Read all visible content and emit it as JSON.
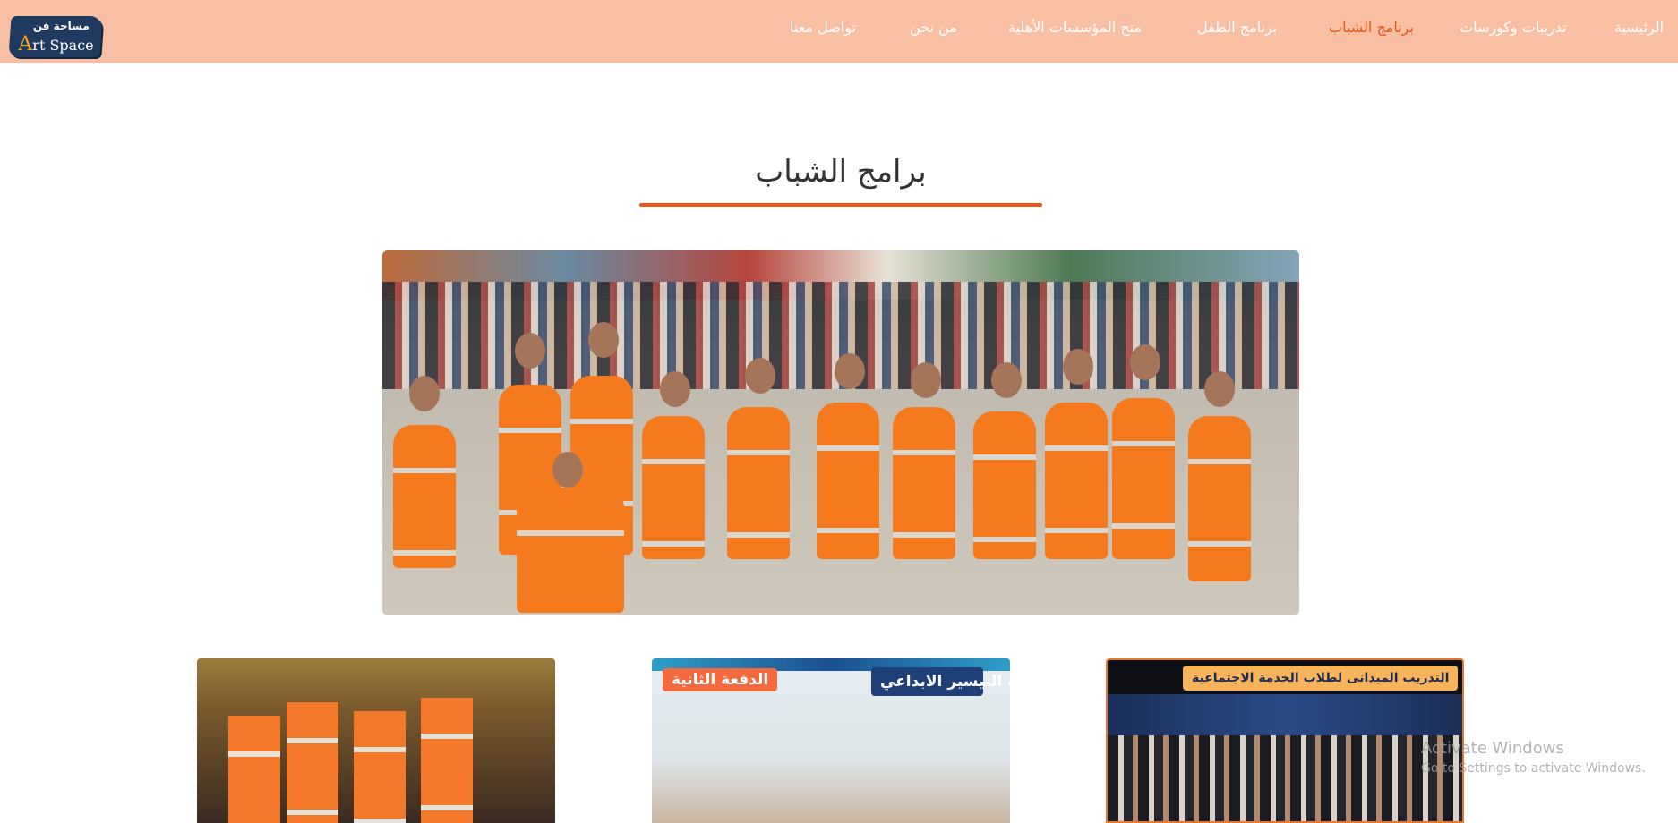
{
  "nav": {
    "logo": {
      "arabic": "مساحة فن",
      "latin": "Art Space",
      "icon": "art-space-logo"
    },
    "items": [
      {
        "label": "الرئيسية",
        "active": false
      },
      {
        "label": "تدريبات وكورسات",
        "active": false
      },
      {
        "label": "برنامج الشباب",
        "active": true
      },
      {
        "label": "برنامج الطفل",
        "active": false
      },
      {
        "label": "منح المؤسسات الأهلية",
        "active": false
      },
      {
        "label": "من نحن",
        "active": false
      },
      {
        "label": "تواصل معنا",
        "active": false
      }
    ],
    "colors": {
      "bar": "#f8bfa3",
      "text": "#ffffff",
      "active": "#e8561b"
    }
  },
  "page": {
    "title": "برامج الشباب",
    "accent_color": "#e8561b"
  },
  "gallery": {
    "hero_alt": "group-photo-volunteers-orange-vests",
    "cards": [
      {
        "tags": []
      },
      {
        "tags": [
          "الدفعة الثانية",
          "تدريب التيسير الابداعي"
        ]
      },
      {
        "tags": [
          "التدريب الميدانى لطلاب الخدمة الاجتماعية"
        ]
      }
    ]
  },
  "watermark": {
    "title": "Activate Windows",
    "subtitle": "Go to Settings to activate Windows."
  }
}
